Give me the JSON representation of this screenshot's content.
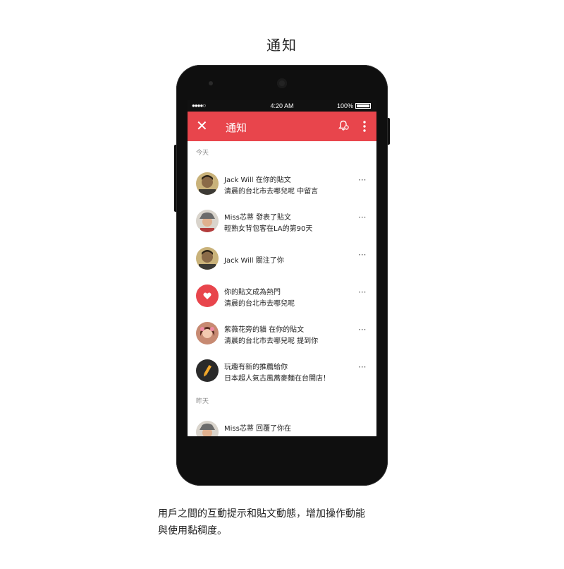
{
  "page": {
    "title": "通知",
    "caption_line1": "用戶之間的互動提示和貼文動態，增加操作動能",
    "caption_line2": "與使用黏稠度。"
  },
  "statusbar": {
    "signal": "●●●●○",
    "time": "4:20 AM",
    "battery_text": "100%",
    "battery_level": 1.0
  },
  "toolbar": {
    "title": "通知",
    "close_icon": "close-icon",
    "bell_icon": "bell-settings-icon",
    "more_icon": "more-vert-icon",
    "color": "#e8454c"
  },
  "sections": {
    "today": "今天",
    "yesterday": "昨天"
  },
  "notifications": [
    {
      "line1": "Jack Will 在你的貼文",
      "line2": "清晨的台北市去哪兒呢 中留言",
      "avatar": "photo-avatar-icon",
      "more": "···"
    },
    {
      "line1": "Miss芯蒂 發表了貼文",
      "line2": "輕熟女背包客在LA的第90天",
      "avatar": "photo-avatar-icon",
      "more": "···"
    },
    {
      "line1": "Jack Will 關注了你",
      "line2": "",
      "avatar": "photo-avatar-icon",
      "more": "···"
    },
    {
      "line1": "你的貼文成為熱門",
      "line2": "清晨的台北市去哪兒呢",
      "avatar": "heart-icon",
      "more": "···"
    },
    {
      "line1": "紫薇花旁的貓 在你的貼文",
      "line2": "清晨的台北市去哪兒呢 提到你",
      "avatar": "photo-avatar-icon",
      "more": "···"
    },
    {
      "line1": "玩趣有新的推薦給你",
      "line2": "日本超人氣古風蕎麥麵在台開店！",
      "avatar": "pencil-icon",
      "more": "···"
    }
  ],
  "yesterday_item": {
    "line1": "Miss芯蒂 回覆了你在"
  }
}
